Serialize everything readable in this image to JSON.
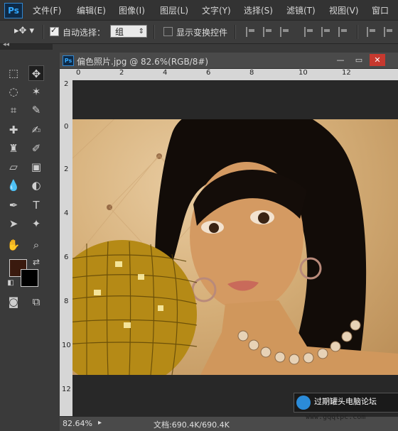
{
  "app": {
    "logo": "Ps"
  },
  "menu": [
    "文件(F)",
    "编辑(E)",
    "图像(I)",
    "图层(L)",
    "文字(Y)",
    "选择(S)",
    "滤镜(T)",
    "视图(V)",
    "窗口"
  ],
  "options": {
    "auto_select_label": "自动选择：",
    "auto_select_value": "组",
    "show_transform_label": "显示变换控件"
  },
  "document": {
    "title": "偏色照片.jpg @ 82.6%(RGB/8#)",
    "ruler_h": [
      "0",
      "2",
      "4",
      "6",
      "8",
      "10",
      "12"
    ],
    "ruler_v": [
      "2",
      "0",
      "2",
      "4",
      "6",
      "8",
      "10",
      "12"
    ],
    "zoom": "82.64%",
    "doc_info": "文档:690.4K/690.4K"
  },
  "watermark": {
    "site": "过期罐头电脑论坛",
    "url": "www.gqqtpc.com"
  },
  "colors": {
    "foreground": "#3a1a0e",
    "background": "#000000"
  }
}
